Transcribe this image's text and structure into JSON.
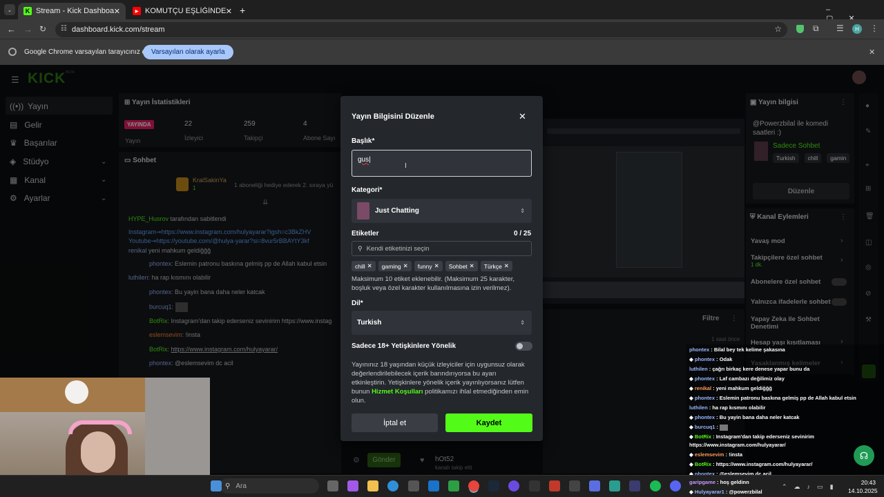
{
  "browser": {
    "tabs": [
      {
        "title": "Stream - Kick Dashboard",
        "favicon": "K",
        "color": "#53fc18"
      },
      {
        "title": "KOMUTÇU EŞLİĞİNDE JAILBREA",
        "favicon": "▶",
        "color": "#ff0000"
      }
    ],
    "url": "dashboard.kick.com/stream",
    "profile_initial": "H",
    "infobar": {
      "message": "Google Chrome varsayılan tarayıcınız değil",
      "button": "Varsayılan olarak ayarla"
    }
  },
  "kick": {
    "logo": "KICK",
    "logo_badge": "BETA",
    "nav": [
      {
        "label": "Yayın",
        "icon": "broadcast-icon"
      },
      {
        "label": "Gelir",
        "icon": "wallet-icon"
      },
      {
        "label": "Başarılar",
        "icon": "trophy-icon"
      },
      {
        "label": "Stüdyo",
        "icon": "studio-icon"
      },
      {
        "label": "Kanal",
        "icon": "channel-icon"
      },
      {
        "label": "Ayarlar",
        "icon": "gear-icon"
      }
    ],
    "stats": {
      "title": "Yayın İstatistikleri",
      "live_badge": "YAYINDA",
      "items": [
        {
          "label": "Yayın",
          "value": ""
        },
        {
          "label": "İzleyici",
          "value": "22"
        },
        {
          "label": "Takipçi",
          "value": "259"
        },
        {
          "label": "Abone Sayı",
          "value": "4"
        }
      ]
    },
    "chat": {
      "title": "Sohbet",
      "pinned_user": "KralSakinYa",
      "pinned_badge": "1",
      "pinned_text": "1 aboneliği hediye ederek 2. sıraya yü",
      "lines": [
        {
          "user": "HYPE_Husrov",
          "text": "tarafından sabitlendi"
        },
        {
          "user": "",
          "text": "Instagram➞https://www.instagram.com/hulyayarar?igsh=c3BkZHV"
        },
        {
          "user": "",
          "text": "Youtube➞https://youtube.com/@hulya-yarar?si=8vur5rBBAYtY3kf"
        },
        {
          "user": "renikal",
          "text": "yeni mahkum geldiğğğ"
        },
        {
          "user": "phontex",
          "text": "Eslemin patronu baskına gelmiş pp de Allah kabul etsin"
        },
        {
          "user": "luthilen",
          "text": "ha rap kısmını olabilir"
        },
        {
          "user": "phontex",
          "text": "Bu yayin bana daha neler katcak"
        },
        {
          "user": "burcuq1",
          "text": ""
        },
        {
          "user": "BotRix",
          "text": "Instagram'dan takip ederseniz sevinirim https://www.instag"
        },
        {
          "user": "eslemsevim",
          "text": "!insta"
        },
        {
          "user": "BotRix",
          "text": "https://www.instagram.com/hulyayarar/"
        },
        {
          "user": "phontex",
          "text": "@eslemsevim dc acil"
        }
      ],
      "send_button": "Gönder"
    },
    "right_panel": {
      "title": "Yayın bilgisi",
      "stream_title": "@Powerzbilal ile komedi saatleri :)",
      "category": "Sadece Sohbet",
      "tags": [
        "Turkish",
        "chill",
        "gamin"
      ],
      "edit_button": "Düzenle",
      "actions_title": "Kanal Eylemleri",
      "actions": [
        {
          "label": "Yavaş mod",
          "sub": ""
        },
        {
          "label": "Takipçilere özel sohbet",
          "sub": "1 dk."
        },
        {
          "label": "Abonelere özel sohbet",
          "sub": ""
        },
        {
          "label": "Yalnızca ifadelerle sohbet",
          "sub": ""
        },
        {
          "label": "Yapay Zeka ile Sohbet Denetimi",
          "sub": ""
        },
        {
          "label": "Hesap yaşı kısıtlaması",
          "sub": ""
        },
        {
          "label": "Yasaklanmış kelimeler",
          "sub": ""
        }
      ]
    },
    "filter": {
      "label": "Filtre",
      "time": "1 saat önce"
    },
    "followers": [
      {
        "name": "hOt52",
        "sub": "kanalı takip etti"
      }
    ],
    "right_chat": [
      {
        "user": "phontex",
        "text": "Bilal bey tek kelime şakasına"
      },
      {
        "user": "phontex",
        "text": "Odak"
      },
      {
        "user": "luthilen",
        "text": "çağrı birkaç kere denese yapar bunu da"
      },
      {
        "user": "phontex",
        "text": "Laf cambazı değilimiz olay"
      },
      {
        "user": "renikal",
        "text": "yeni mahkum geldiğğğ"
      },
      {
        "user": "phontex",
        "text": "Eslemin patronu baskına gelmiş pp de Allah kabul etsin"
      },
      {
        "user": "luthilen",
        "text": "ha rap kısmını olabilir"
      },
      {
        "user": "phontex",
        "text": "Bu yayin bana daha neler katcak"
      },
      {
        "user": "burcuq1",
        "text": ""
      },
      {
        "user": "BotRix",
        "text": "Instagram'dan takip ederseniz sevinirim"
      },
      {
        "user": "",
        "text": "https://www.instagram.com/hulyayarar/"
      },
      {
        "user": "eslemsevim",
        "text": "!insta"
      },
      {
        "user": "BotRix",
        "text": "https://www.instagram.com/hulyayarar/"
      },
      {
        "user": "phontex",
        "text": "@eslemsevim dc acil"
      },
      {
        "user": "garipgame",
        "text": "hoş geldinn"
      },
      {
        "user": "Hulyayarar1",
        "text": "@powerzbilal"
      }
    ]
  },
  "modal": {
    "title": "Yayın Bilgisini Düzenle",
    "title_label": "Başlık*",
    "title_value": "gus",
    "category_label": "Kategori*",
    "category_value": "Just Chatting",
    "tags_label": "Etiketler",
    "tags_count": "0 / 25",
    "tags_placeholder": "Kendi etiketinizi seçin",
    "tags": [
      "chill",
      "gaming",
      "funny",
      "Sohbet",
      "Türkçe"
    ],
    "tags_help": "Maksimum 10 etiket eklenebilir. (Maksimum 25 karakter, boşluk veya özel karakter kullanılmasına izin verilmez).",
    "language_label": "Dil*",
    "language_value": "Turkish",
    "mature_label": "Sadece 18+ Yetişkinlere Yönelik",
    "mature_text_before": "Yayınınız 18 yaşından küçük izleyiciler için uygunsuz olarak değerlendirilebilecek içerik barındırıyorsa bu ayarı etkinleştirin. Yetişkinlere yönelik içerik yayınlıyorsanız lütfen bunun ",
    "mature_link": "Hizmet Koşulları",
    "mature_text_after": " politikamızı ihlal etmediğinden emin olun.",
    "cancel_button": "İptal et",
    "save_button": "Kaydet"
  },
  "taskbar": {
    "search_placeholder": "Ara",
    "time": "20:43",
    "date": "14.10.2025"
  },
  "colors": {
    "kick_green": "#53fc18",
    "link_green": "#53fc18",
    "modal_bg": "#24272c"
  }
}
